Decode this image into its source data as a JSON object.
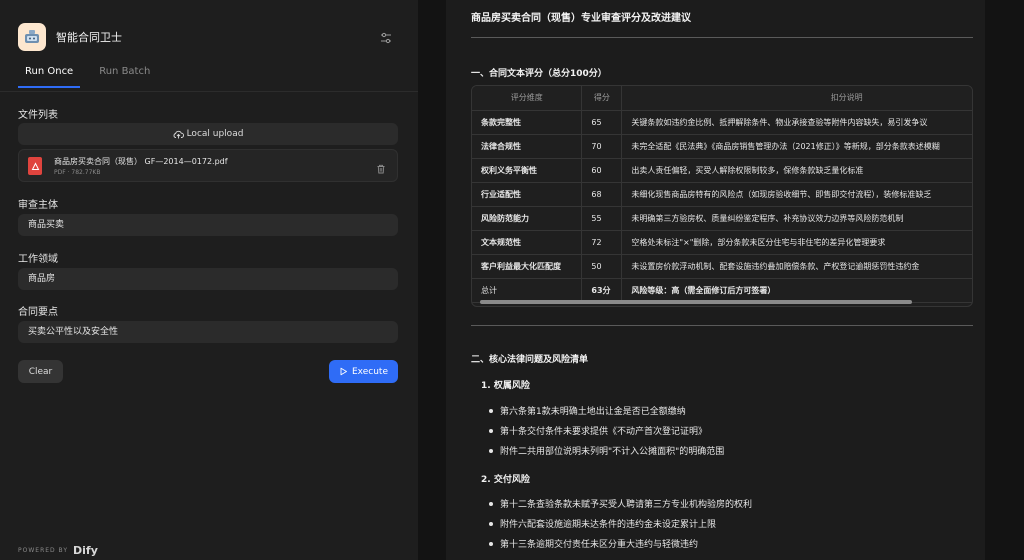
{
  "app": {
    "title": "智能合同卫士"
  },
  "tabs": [
    {
      "label": "Run Once",
      "active": true
    },
    {
      "label": "Run Batch",
      "active": false
    }
  ],
  "form": {
    "file_list_label": "文件列表",
    "upload_label": "Local upload",
    "file": {
      "name": "商品房买卖合同（现售）  GF—2014—0172.pdf",
      "meta": "PDF · 782.77KB"
    },
    "subject_label": "审查主体",
    "subject_value": "商品买卖",
    "domain_label": "工作领域",
    "domain_value": "商品房",
    "points_label": "合同要点",
    "points_value": "买卖公平性以及安全性",
    "clear_label": "Clear",
    "execute_label": "Execute"
  },
  "footer": {
    "powered_by": "POWERED BY",
    "brand": "Dify"
  },
  "result": {
    "title": "商品房买卖合同（现售）专业审查评分及改进建议",
    "section1_title": "一、合同文本评分（总分100分）",
    "table": {
      "headers": [
        "评分维度",
        "得分",
        "扣分说明"
      ],
      "rows": [
        [
          "条款完整性",
          "65",
          "关键条款如违约金比例、抵押解除条件、物业承接查验等附件内容缺失，易引发争议"
        ],
        [
          "法律合规性",
          "70",
          "未完全适配《民法典》《商品房销售管理办法（2021修正）》等新规，部分条款表述模糊"
        ],
        [
          "权利义务平衡性",
          "60",
          "出卖人责任偏轻，买受人解除权限制较多，保修条款缺乏量化标准"
        ],
        [
          "行业适配性",
          "68",
          "未细化现售商品房特有的风险点（如现房验收细节、即售即交付流程），装修标准缺乏"
        ],
        [
          "风险防范能力",
          "55",
          "未明确第三方验房权、质量纠纷鉴定程序、补充协议效力边界等风险防范机制"
        ],
        [
          "文本规范性",
          "72",
          "空格处未标注\"×\"删除，部分条款未区分住宅与非住宅的差异化管理要求"
        ],
        [
          "客户利益最大化匹配度",
          "50",
          "未设置房价款浮动机制、配套设施违约叠加赔偿条款、产权登记逾期惩罚性违约金"
        ],
        [
          "总计",
          "63分",
          "风险等级：高（需全面修订后方可签署）"
        ]
      ]
    },
    "section2_title": "二、核心法律问题及风险清单",
    "sub1_title": "1. 权属风险",
    "sub1_items": [
      "第六条第1款未明确土地出让金是否已全额缴纳",
      "第十条交付条件未要求提供《不动产首次登记证明》",
      "附件二共用部位说明未列明\"不计入公摊面积\"的明确范围"
    ],
    "sub2_title": "2. 交付风险",
    "sub2_items": [
      "第十二条查验条款未赋予买受人聘请第三方专业机构验房的权利",
      "附件六配套设施逾期未达条件的违约金未设定累计上限",
      "第十三条逾期交付责任未区分重大违约与轻微违约"
    ]
  }
}
